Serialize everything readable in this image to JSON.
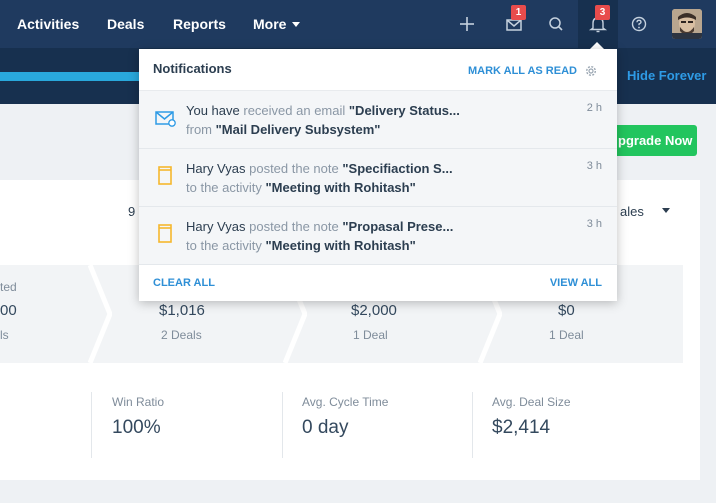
{
  "nav": {
    "items": [
      "Activities",
      "Deals",
      "Reports"
    ],
    "more_label": "More",
    "mail_badge": "1",
    "bell_badge": "3"
  },
  "subbar": {
    "hide_forever": "Hide Forever"
  },
  "main": {
    "upgrade_fragment": "pgrade Now",
    "date_fragment": "9",
    "filter_fragment": "ales",
    "stages": [
      {
        "label": "ted",
        "amount": "00",
        "count": "ls"
      },
      {
        "label": "",
        "amount": "$1,016",
        "count": "2 Deals"
      },
      {
        "label": "",
        "amount": "$2,000",
        "count": "1 Deal"
      },
      {
        "label": "",
        "amount": "$0",
        "count": "1 Deal"
      }
    ],
    "metrics": [
      {
        "label": "Win Ratio",
        "value": "100%"
      },
      {
        "label": "Avg. Cycle Time",
        "value": "0 day"
      },
      {
        "label": "Avg. Deal Size",
        "value": "$2,414"
      }
    ]
  },
  "notifications": {
    "title": "Notifications",
    "mark_all_label": "MARK ALL AS READ",
    "items": [
      {
        "icon": "mail-icon",
        "actor": "You have",
        "action": "received an email",
        "object": "\"Delivery Status...",
        "connector": "from",
        "target": "\"Mail Delivery Subsystem\"",
        "time": "2 h"
      },
      {
        "icon": "note-icon",
        "actor": "Hary Vyas",
        "action": "posted the note",
        "object": "\"Specifiaction S...",
        "connector": "to the activity",
        "target": "\"Meeting with Rohitash\"",
        "time": "3 h"
      },
      {
        "icon": "note-icon",
        "actor": "Hary Vyas",
        "action": "posted the note",
        "object": "\"Propasal Prese...",
        "connector": "to the activity",
        "target": "\"Meeting with Rohitash\"",
        "time": "3 h"
      }
    ],
    "clear_all_label": "CLEAR ALL",
    "view_all_label": "VIEW ALL"
  },
  "colors": {
    "nav_bg": "#1f3a5f",
    "accent_blue": "#2e8fd6",
    "upgrade_green": "#22c55e",
    "badge_red": "#e84c4c",
    "note_yellow": "#f5b82e"
  }
}
